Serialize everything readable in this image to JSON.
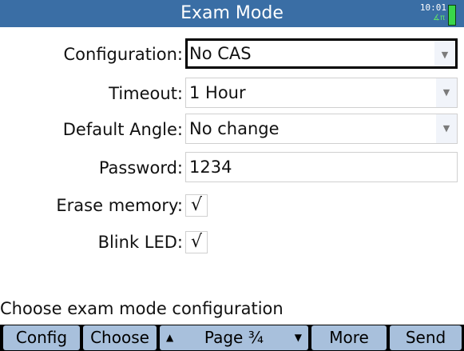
{
  "app": {
    "title": "Exam Mode",
    "clock": "10:01",
    "angle_indicator": "∡π",
    "battery_color": "#39d64a"
  },
  "form": {
    "configuration": {
      "label": "Configuration:",
      "value": "No CAS"
    },
    "timeout": {
      "label": "Timeout:",
      "value": "1 Hour"
    },
    "default_angle": {
      "label": "Default Angle:",
      "value": "No change"
    },
    "password": {
      "label": "Password:",
      "value": "1234"
    },
    "erase_memory": {
      "label": "Erase memory:",
      "mark": "√"
    },
    "blink_led": {
      "label": "Blink LED:",
      "mark": "√"
    }
  },
  "help_text": "Choose exam mode configuration",
  "menu": {
    "config": "Config",
    "choose": "Choose",
    "page": "Page ³⁄₄",
    "more": "More",
    "send": "Send"
  },
  "colors": {
    "titlebar": "#3a6ea5",
    "menu_key": "#a8c0dc",
    "focus_border": "#000000"
  }
}
